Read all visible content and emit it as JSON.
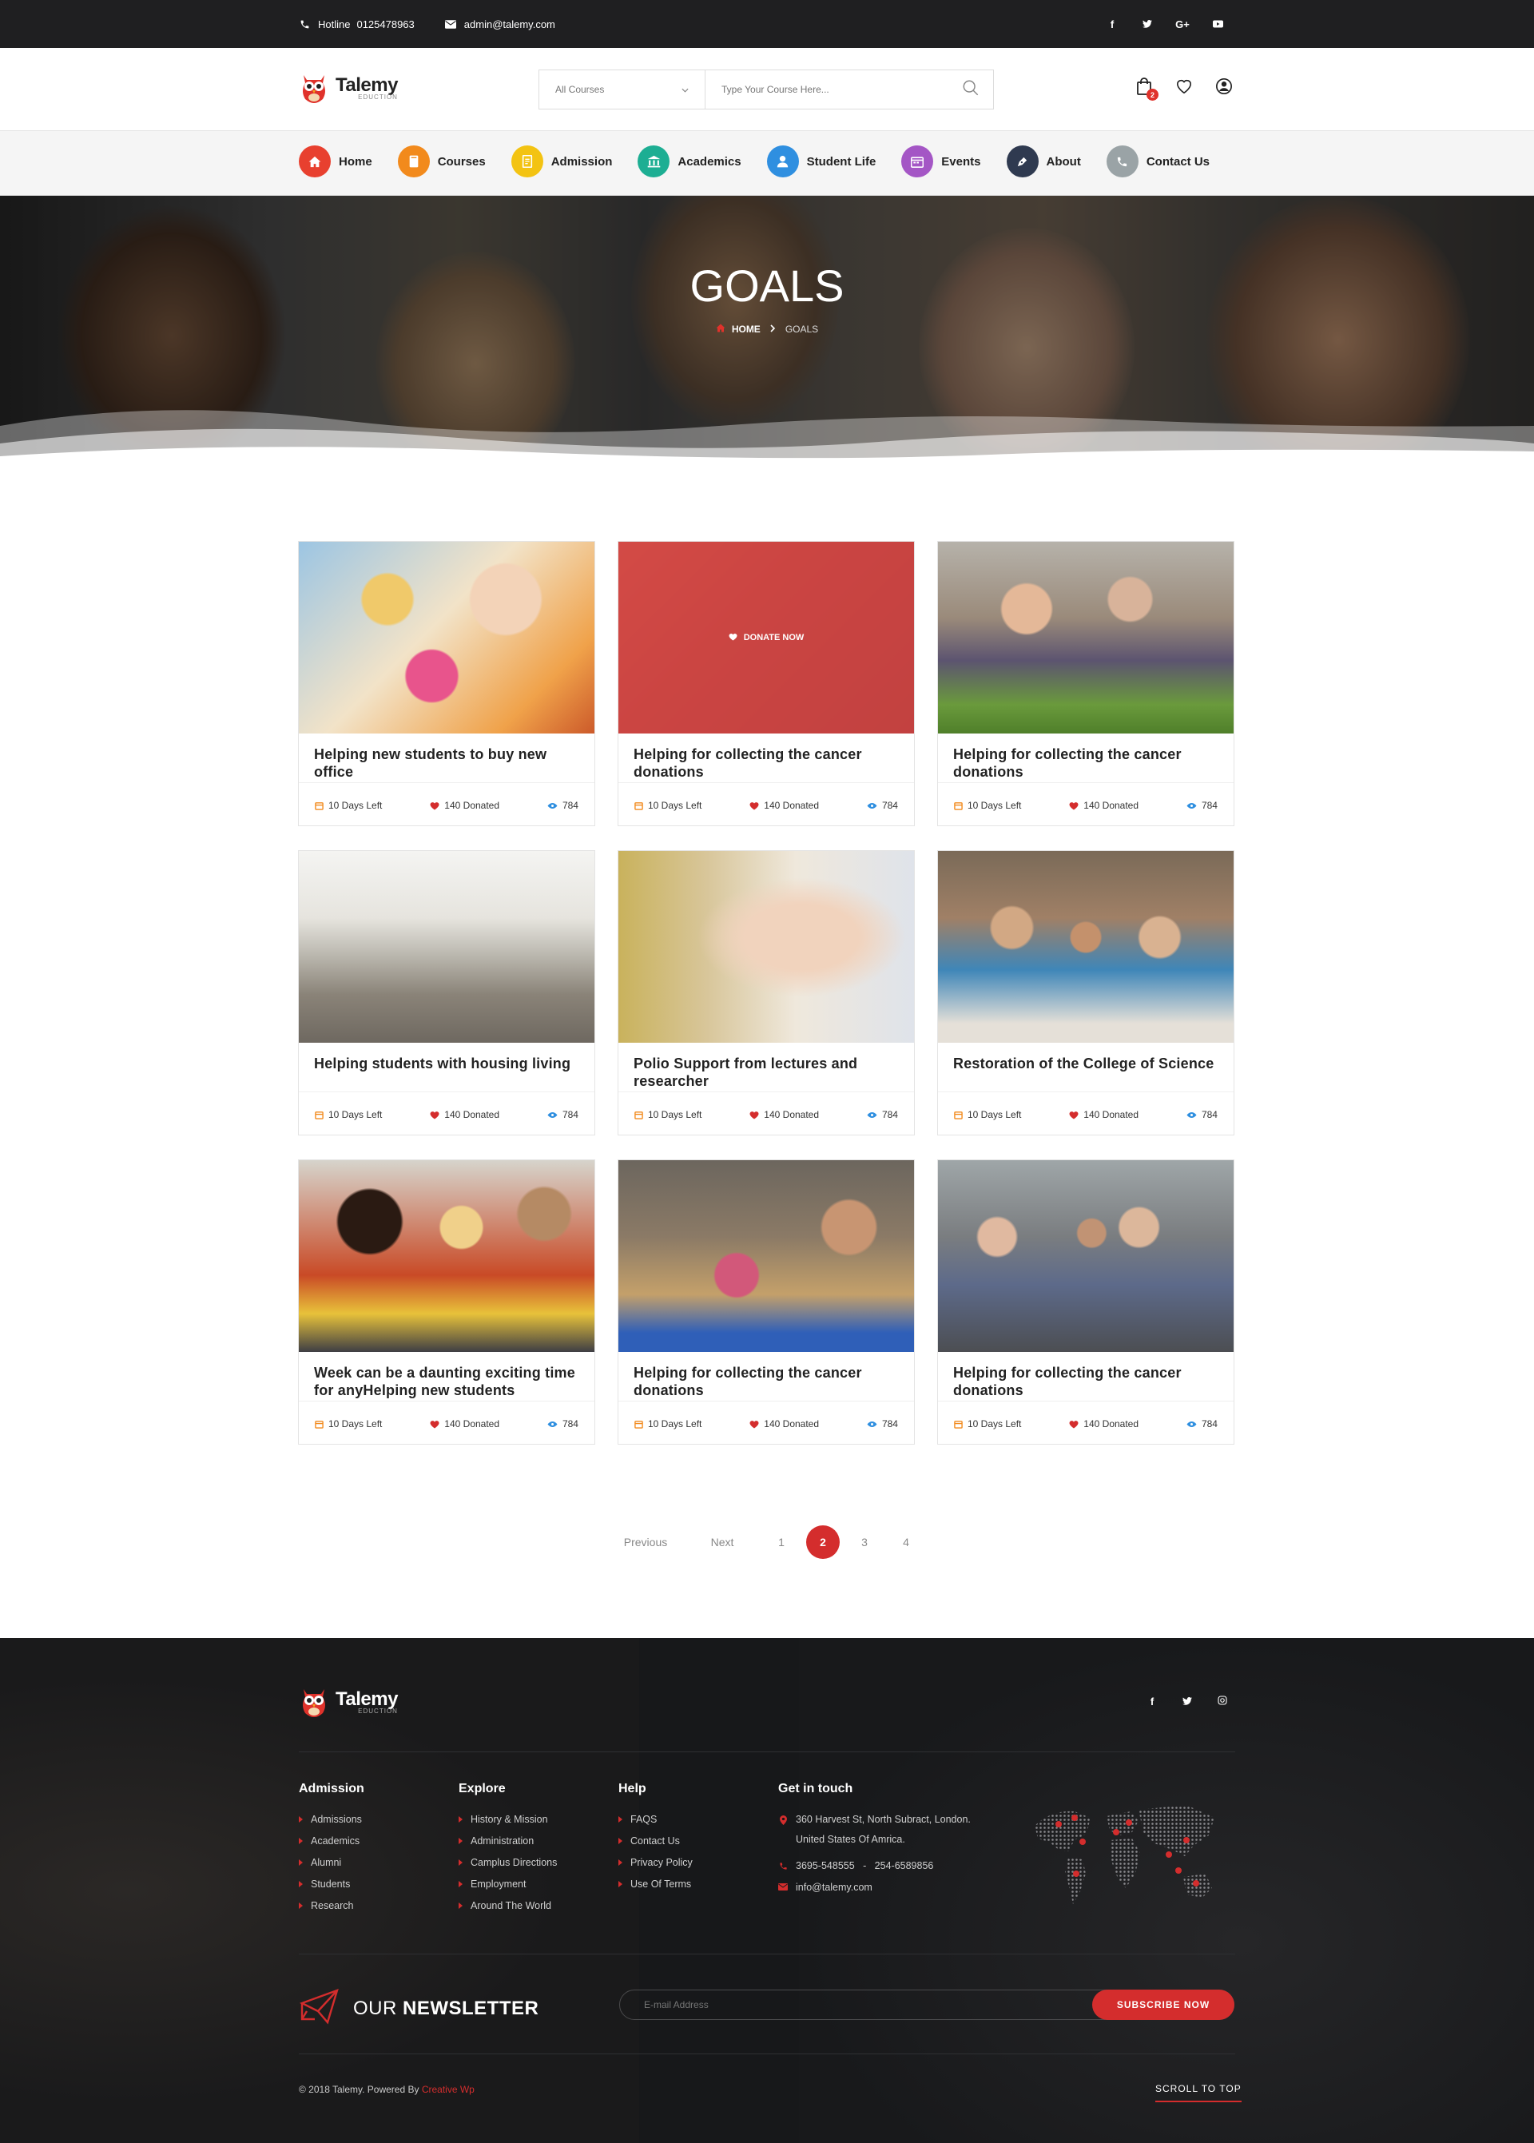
{
  "topbar": {
    "hotline_label": "Hotline",
    "hotline_number": "0125478963",
    "email": "admin@talemy.com",
    "social": [
      "f",
      "t",
      "G+",
      "yt"
    ]
  },
  "header": {
    "brand": "Talemy",
    "brand_sub": "EDUCTION",
    "category_select": "All Courses",
    "search_placeholder": "Type Your Course Here...",
    "cart_count": "2"
  },
  "nav": {
    "items": [
      {
        "label": "Home",
        "icon": "home-icon",
        "color": "#e8402f"
      },
      {
        "label": "Courses",
        "icon": "book-icon",
        "color": "#f28a1c"
      },
      {
        "label": "Admission",
        "icon": "document-icon",
        "color": "#f3c312"
      },
      {
        "label": "Academics",
        "icon": "building-icon",
        "color": "#1dae93"
      },
      {
        "label": "Student Life",
        "icon": "user-icon",
        "color": "#2f8fe0"
      },
      {
        "label": "Events",
        "icon": "calendar-icon",
        "color": "#a456c5"
      },
      {
        "label": "About",
        "icon": "pen-icon",
        "color": "#2f3a50"
      },
      {
        "label": "Contact Us",
        "icon": "phone-icon",
        "color": "#9aa3a6"
      }
    ]
  },
  "hero": {
    "title": "GOALS",
    "breadcrumb_home": "HOME",
    "breadcrumb_current": "GOALS"
  },
  "cards": [
    {
      "title": "Helping new students to buy new office",
      "days": "10 Days Left",
      "donated": "140 Donated",
      "views": "784"
    },
    {
      "title": "Helping for collecting the cancer donations",
      "days": "10 Days Left",
      "donated": "140 Donated",
      "views": "784",
      "overlay": "DONATE NOW"
    },
    {
      "title": "Helping for collecting the cancer donations",
      "days": "10 Days Left",
      "donated": "140 Donated",
      "views": "784"
    },
    {
      "title": "Helping students with housing living",
      "days": "10 Days Left",
      "donated": "140 Donated",
      "views": "784"
    },
    {
      "title": "Polio Support from lectures and researcher",
      "days": "10 Days Left",
      "donated": "140 Donated",
      "views": "784"
    },
    {
      "title": "Restoration of the College of Science",
      "days": "10 Days Left",
      "donated": "140 Donated",
      "views": "784"
    },
    {
      "title": "Week can be a daunting exciting time for anyHelping new students",
      "days": "10 Days Left",
      "donated": "140 Donated",
      "views": "784"
    },
    {
      "title": "Helping for collecting the cancer donations",
      "days": "10 Days Left",
      "donated": "140 Donated",
      "views": "784"
    },
    {
      "title": "Helping for collecting the cancer donations",
      "days": "10 Days Left",
      "donated": "140 Donated",
      "views": "784"
    }
  ],
  "pagination": {
    "previous": "Previous",
    "next": "Next",
    "pages": [
      "1",
      "2",
      "3",
      "4"
    ],
    "current": "2"
  },
  "footer": {
    "brand": "Talemy",
    "brand_sub": "EDUCTION",
    "social": [
      "f",
      "t",
      "ig"
    ],
    "admission": {
      "heading": "Admission",
      "links": [
        "Admissions",
        "Academics",
        "Alumni",
        "Students",
        "Research"
      ]
    },
    "explore": {
      "heading": "Explore",
      "links": [
        "History & Mission",
        "Administration",
        "Camplus Directions",
        "Employment",
        "Around The World"
      ]
    },
    "help": {
      "heading": "Help",
      "links": [
        "FAQS",
        "Contact Us",
        "Privacy Policy",
        "Use Of Terms"
      ]
    },
    "contact": {
      "heading": "Get in touch",
      "address_line1": "360 Harvest St, North Subract, London.",
      "address_line2": "United States Of Amrica.",
      "phone": "3695-548555   -   254-6589856",
      "email": "info@talemy.com"
    },
    "newsletter": {
      "title_light": "OUR",
      "title_bold": "NEWSLETTER",
      "placeholder": "E-mail Address",
      "button": "SUBSCRIBE NOW"
    },
    "copyright": "© 2018 Talemy.  Powered By",
    "powered_by": "Creative Wp",
    "scroll_top": "SCROLL TO TOP"
  }
}
